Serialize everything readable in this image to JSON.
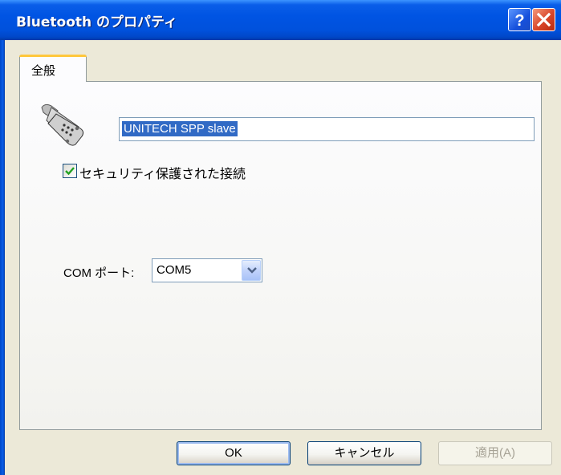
{
  "window": {
    "title": "Bluetooth のプロパティ",
    "help_icon": "help-question-icon",
    "close_icon": "close-x-icon"
  },
  "tabs": [
    {
      "label": "全般",
      "selected": true
    }
  ],
  "device": {
    "icon": "serial-port-connector-icon",
    "name_value": "UNITECH SPP slave"
  },
  "secure_connection": {
    "label": "セキュリティ保護された接続",
    "checked": true
  },
  "com_port": {
    "label": "COM ポート:",
    "selected": "COM5"
  },
  "buttons": {
    "ok": "OK",
    "cancel": "キャンセル",
    "apply": "適用(A)"
  },
  "colors": {
    "titlebar": "#0054e3",
    "selection": "#316ac5",
    "tab_highlight": "#ffc73c"
  }
}
